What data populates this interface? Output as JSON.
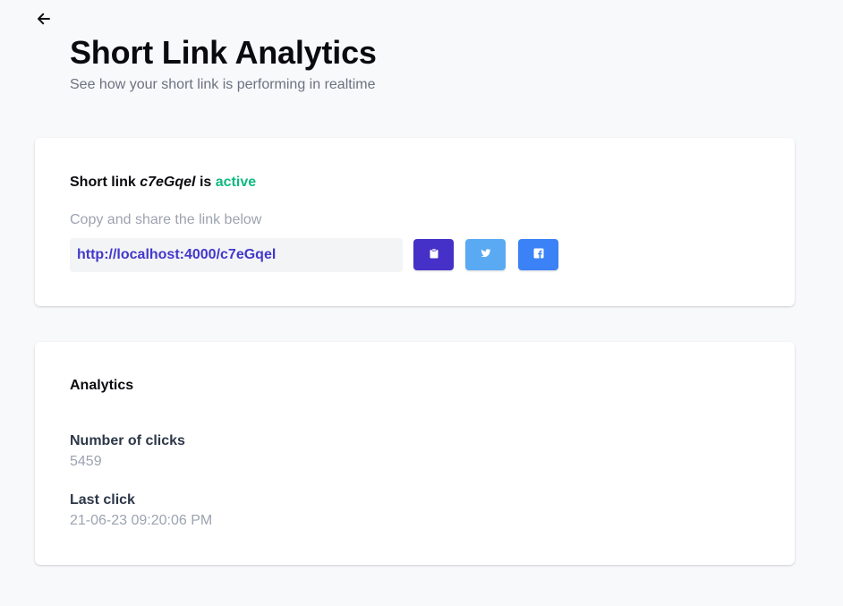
{
  "header": {
    "back_icon": "arrow-left-icon",
    "title": "Short Link Analytics",
    "subtitle": "See how your short link is performing in realtime"
  },
  "share_card": {
    "status_prefix": "Short link",
    "code": "c7eGqel",
    "status_connector": "is",
    "status": "active",
    "copy_hint": "Copy and share the link below",
    "link": "http://localhost:4000/c7eGqel",
    "buttons": [
      {
        "icon": "clipboard-icon",
        "color": "#4531c7"
      },
      {
        "icon": "twitter-icon",
        "color": "#5aaaf3"
      },
      {
        "icon": "facebook-icon",
        "color": "#3b82f6"
      }
    ],
    "status_color": "#10b981",
    "link_color": "#4338ca"
  },
  "analytics_card": {
    "title": "Analytics",
    "clicks_label": "Number of clicks",
    "clicks_value": "5459",
    "last_click_label": "Last click",
    "last_click_value": "21-06-23 09:20:06 PM"
  }
}
